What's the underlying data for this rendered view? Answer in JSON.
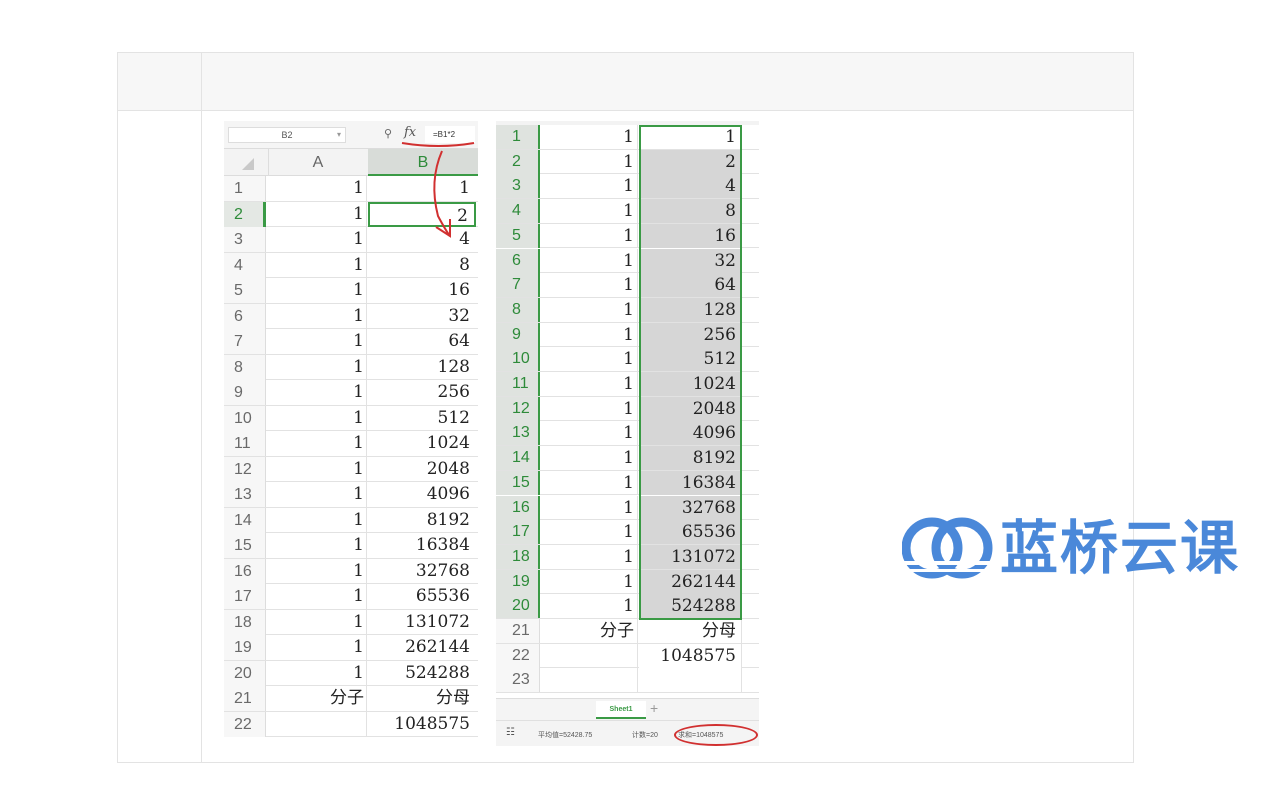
{
  "left_sheet": {
    "name_box": "B2",
    "formula": "=B1*2",
    "col_a": "A",
    "col_b": "B",
    "rows": [
      {
        "n": "1",
        "a": "1",
        "b": "1"
      },
      {
        "n": "2",
        "a": "1",
        "b": "2"
      },
      {
        "n": "3",
        "a": "1",
        "b": "4"
      },
      {
        "n": "4",
        "a": "1",
        "b": "8"
      },
      {
        "n": "5",
        "a": "1",
        "b": "16"
      },
      {
        "n": "6",
        "a": "1",
        "b": "32"
      },
      {
        "n": "7",
        "a": "1",
        "b": "64"
      },
      {
        "n": "8",
        "a": "1",
        "b": "128"
      },
      {
        "n": "9",
        "a": "1",
        "b": "256"
      },
      {
        "n": "10",
        "a": "1",
        "b": "512"
      },
      {
        "n": "11",
        "a": "1",
        "b": "1024"
      },
      {
        "n": "12",
        "a": "1",
        "b": "2048"
      },
      {
        "n": "13",
        "a": "1",
        "b": "4096"
      },
      {
        "n": "14",
        "a": "1",
        "b": "8192"
      },
      {
        "n": "15",
        "a": "1",
        "b": "16384"
      },
      {
        "n": "16",
        "a": "1",
        "b": "32768"
      },
      {
        "n": "17",
        "a": "1",
        "b": "65536"
      },
      {
        "n": "18",
        "a": "1",
        "b": "131072"
      },
      {
        "n": "19",
        "a": "1",
        "b": "262144"
      },
      {
        "n": "20",
        "a": "1",
        "b": "524288"
      },
      {
        "n": "21",
        "a": "分子",
        "b": "分母"
      },
      {
        "n": "22",
        "a": "",
        "b": "1048575"
      }
    ]
  },
  "right_sheet": {
    "rows": [
      {
        "n": "1",
        "a": "1",
        "b": "1"
      },
      {
        "n": "2",
        "a": "1",
        "b": "2"
      },
      {
        "n": "3",
        "a": "1",
        "b": "4"
      },
      {
        "n": "4",
        "a": "1",
        "b": "8"
      },
      {
        "n": "5",
        "a": "1",
        "b": "16"
      },
      {
        "n": "6",
        "a": "1",
        "b": "32"
      },
      {
        "n": "7",
        "a": "1",
        "b": "64"
      },
      {
        "n": "8",
        "a": "1",
        "b": "128"
      },
      {
        "n": "9",
        "a": "1",
        "b": "256"
      },
      {
        "n": "10",
        "a": "1",
        "b": "512"
      },
      {
        "n": "11",
        "a": "1",
        "b": "1024"
      },
      {
        "n": "12",
        "a": "1",
        "b": "2048"
      },
      {
        "n": "13",
        "a": "1",
        "b": "4096"
      },
      {
        "n": "14",
        "a": "1",
        "b": "8192"
      },
      {
        "n": "15",
        "a": "1",
        "b": "16384"
      },
      {
        "n": "16",
        "a": "1",
        "b": "32768"
      },
      {
        "n": "17",
        "a": "1",
        "b": "65536"
      },
      {
        "n": "18",
        "a": "1",
        "b": "131072"
      },
      {
        "n": "19",
        "a": "1",
        "b": "262144"
      },
      {
        "n": "20",
        "a": "1",
        "b": "524288"
      },
      {
        "n": "21",
        "a": "分子",
        "b": "分母"
      },
      {
        "n": "22",
        "a": "",
        "b": "1048575"
      },
      {
        "n": "23",
        "a": "",
        "b": ""
      }
    ],
    "sheet_tab": "Sheet1",
    "add_tab": "+",
    "status_avg": "平均值=52428.75",
    "status_count": "计数=20",
    "status_sum": "求和=1048575"
  },
  "watermark": {
    "text": "蓝桥云课",
    "color": "#4a88d9"
  },
  "icons": {
    "zoom": "magnifier-icon",
    "fx": "fx"
  }
}
